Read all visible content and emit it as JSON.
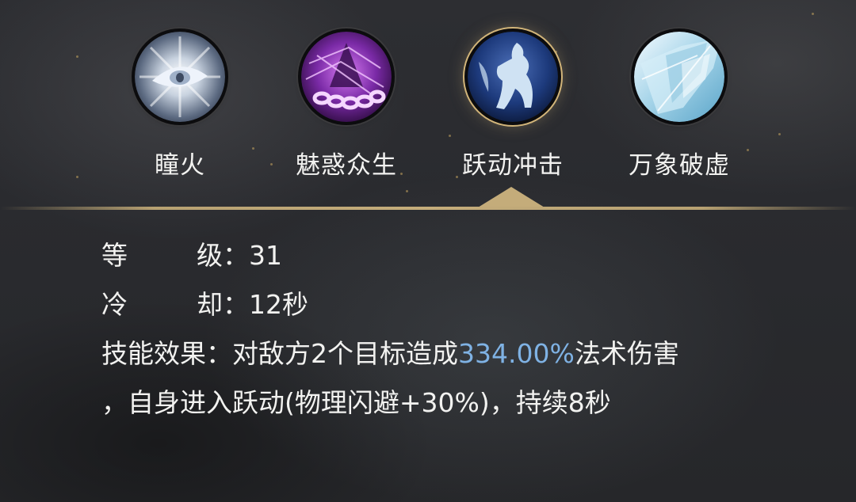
{
  "skills": [
    {
      "name": "瞳火",
      "icon": "eye-flame-icon",
      "active": false
    },
    {
      "name": "魅惑众生",
      "icon": "purple-chain-charm-icon",
      "active": false
    },
    {
      "name": "跃动冲击",
      "icon": "leaping-figure-icon",
      "active": true
    },
    {
      "name": "万象破虚",
      "icon": "ice-crystal-icon",
      "active": false
    }
  ],
  "details": {
    "level_label_1": "等",
    "level_label_2": "级：",
    "level_value": "31",
    "cooldown_label_1": "冷",
    "cooldown_label_2": "却：",
    "cooldown_value": "12秒",
    "effect_label": "技能效果：",
    "effect_part1": "对敌方2个目标造成",
    "effect_highlight": "334.00%",
    "effect_part2": "法术伤害",
    "effect_line2": "，自身进入跃动(物理闪避+30%)，持续8秒"
  },
  "colors": {
    "text": "#f2f2f0",
    "highlight": "#7fb2e4",
    "accent_gold": "#c4ac7a",
    "background": "#2a2b2f"
  }
}
